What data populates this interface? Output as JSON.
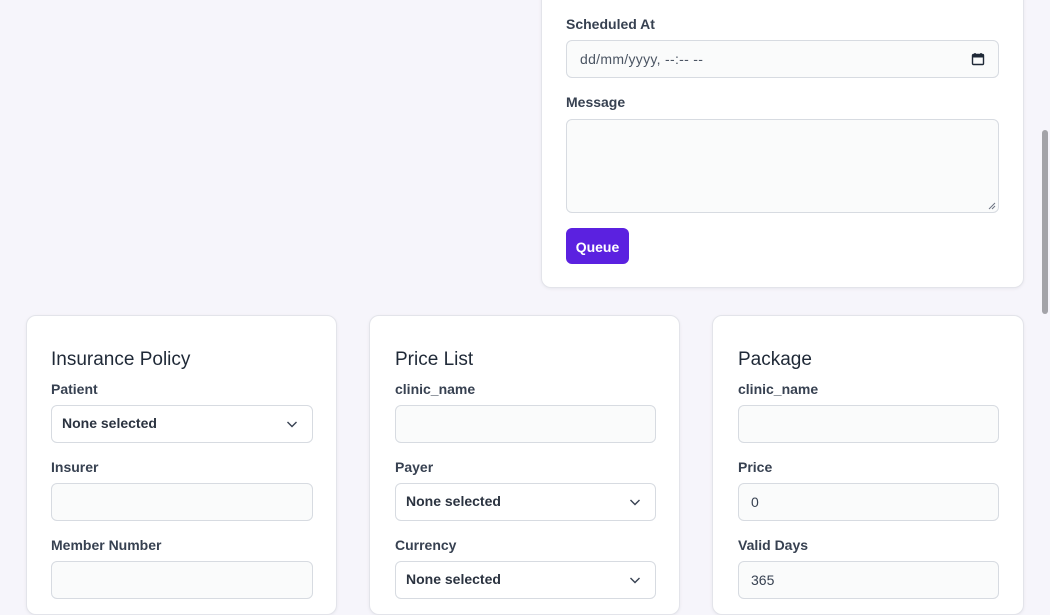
{
  "notification": {
    "scheduled_at_label": "Scheduled At",
    "scheduled_at_value": "dd/mm/yyyy, --:-- --",
    "message_label": "Message",
    "message_value": "",
    "queue_label": "Queue"
  },
  "insurance_policy": {
    "title": "Insurance Policy",
    "patient_label": "Patient",
    "patient_value": "None selected",
    "insurer_label": "Insurer",
    "insurer_value": "",
    "member_number_label": "Member Number",
    "member_number_value": ""
  },
  "price_list": {
    "title": "Price List",
    "clinic_name_label": "clinic_name",
    "clinic_name_value": "",
    "payer_label": "Payer",
    "payer_value": "None selected",
    "currency_label": "Currency",
    "currency_value": "None selected"
  },
  "package": {
    "title": "Package",
    "clinic_name_label": "clinic_name",
    "clinic_name_value": "",
    "price_label": "Price",
    "price_value": "0",
    "valid_days_label": "Valid Days",
    "valid_days_value": "365"
  },
  "colors": {
    "accent": "#5b21e0",
    "background": "#f6f5fb"
  },
  "icons": {
    "select": "chevron-down-icon",
    "datetime": "calendar-icon"
  }
}
